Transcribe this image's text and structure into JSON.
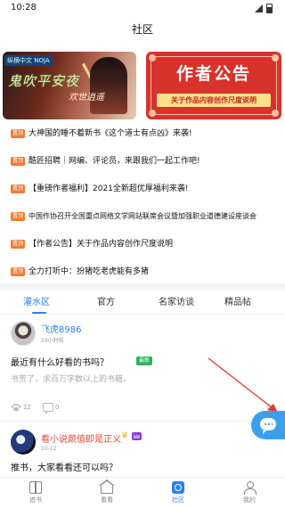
{
  "status_bar": {
    "time": "10:28"
  },
  "header": {
    "title": "社区"
  },
  "banners": [
    {
      "tag": "纵横中文 NOJA",
      "calligraphy_1": "鬼吹平安夜",
      "calligraphy_2": "欢世逍遥"
    },
    {
      "title": "作者公告",
      "subtitle": "关于作品内容创作尺度说明"
    }
  ],
  "notices": [
    {
      "badge": "置顶",
      "text": "大神国的睡不着新书《这个道士有点凶》来袭!"
    },
    {
      "badge": "置顶",
      "text": "酷匠招聘｜网编、评论员，来跟我们一起工作吧!"
    },
    {
      "badge": "置顶",
      "text": "【重磅作者福利】2021全新超优厚福利来袭!"
    },
    {
      "badge": "置顶",
      "text": "中国作协召开全国重点网络文学网站联席会议暨加强职业道德建设座谈会"
    },
    {
      "badge": "置顶",
      "text": "【作者公告】关于作品内容创作尺度说明"
    },
    {
      "badge": "置顶",
      "text": "全力打听中：扮猪吃老虎能有多猪"
    }
  ],
  "tabs": [
    {
      "label": "灌水区",
      "active": true
    },
    {
      "label": "官方",
      "active": false
    },
    {
      "label": "名家访谈",
      "active": false
    },
    {
      "label": "精品帖",
      "active": false
    }
  ],
  "posts": [
    {
      "username": "飞虎8986",
      "time": "19小时前",
      "title": "最近有什么好看的书吗？",
      "badge": "最新",
      "body": "书荒了，求百万字数以上的书籍。",
      "likes": "12",
      "comments": "0"
    },
    {
      "username": "看小说颜值即是正义",
      "time": "10-12",
      "title": "推书，大家看看还可以吗？"
    }
  ],
  "bottom_nav": [
    {
      "label": "追书",
      "icon": "book-icon",
      "active": false
    },
    {
      "label": "看看",
      "icon": "home-icon",
      "active": false
    },
    {
      "label": "社区",
      "icon": "community-icon",
      "active": true
    },
    {
      "label": "我的",
      "icon": "user-icon",
      "active": false
    }
  ],
  "colors": {
    "accent": "#2d7ff0",
    "badge_orange": "#f07b35",
    "badge_green": "#28b45c",
    "banner_red": "#d8322c",
    "fab_blue": "#3aa0ec",
    "vip_username": "#e0473a"
  }
}
